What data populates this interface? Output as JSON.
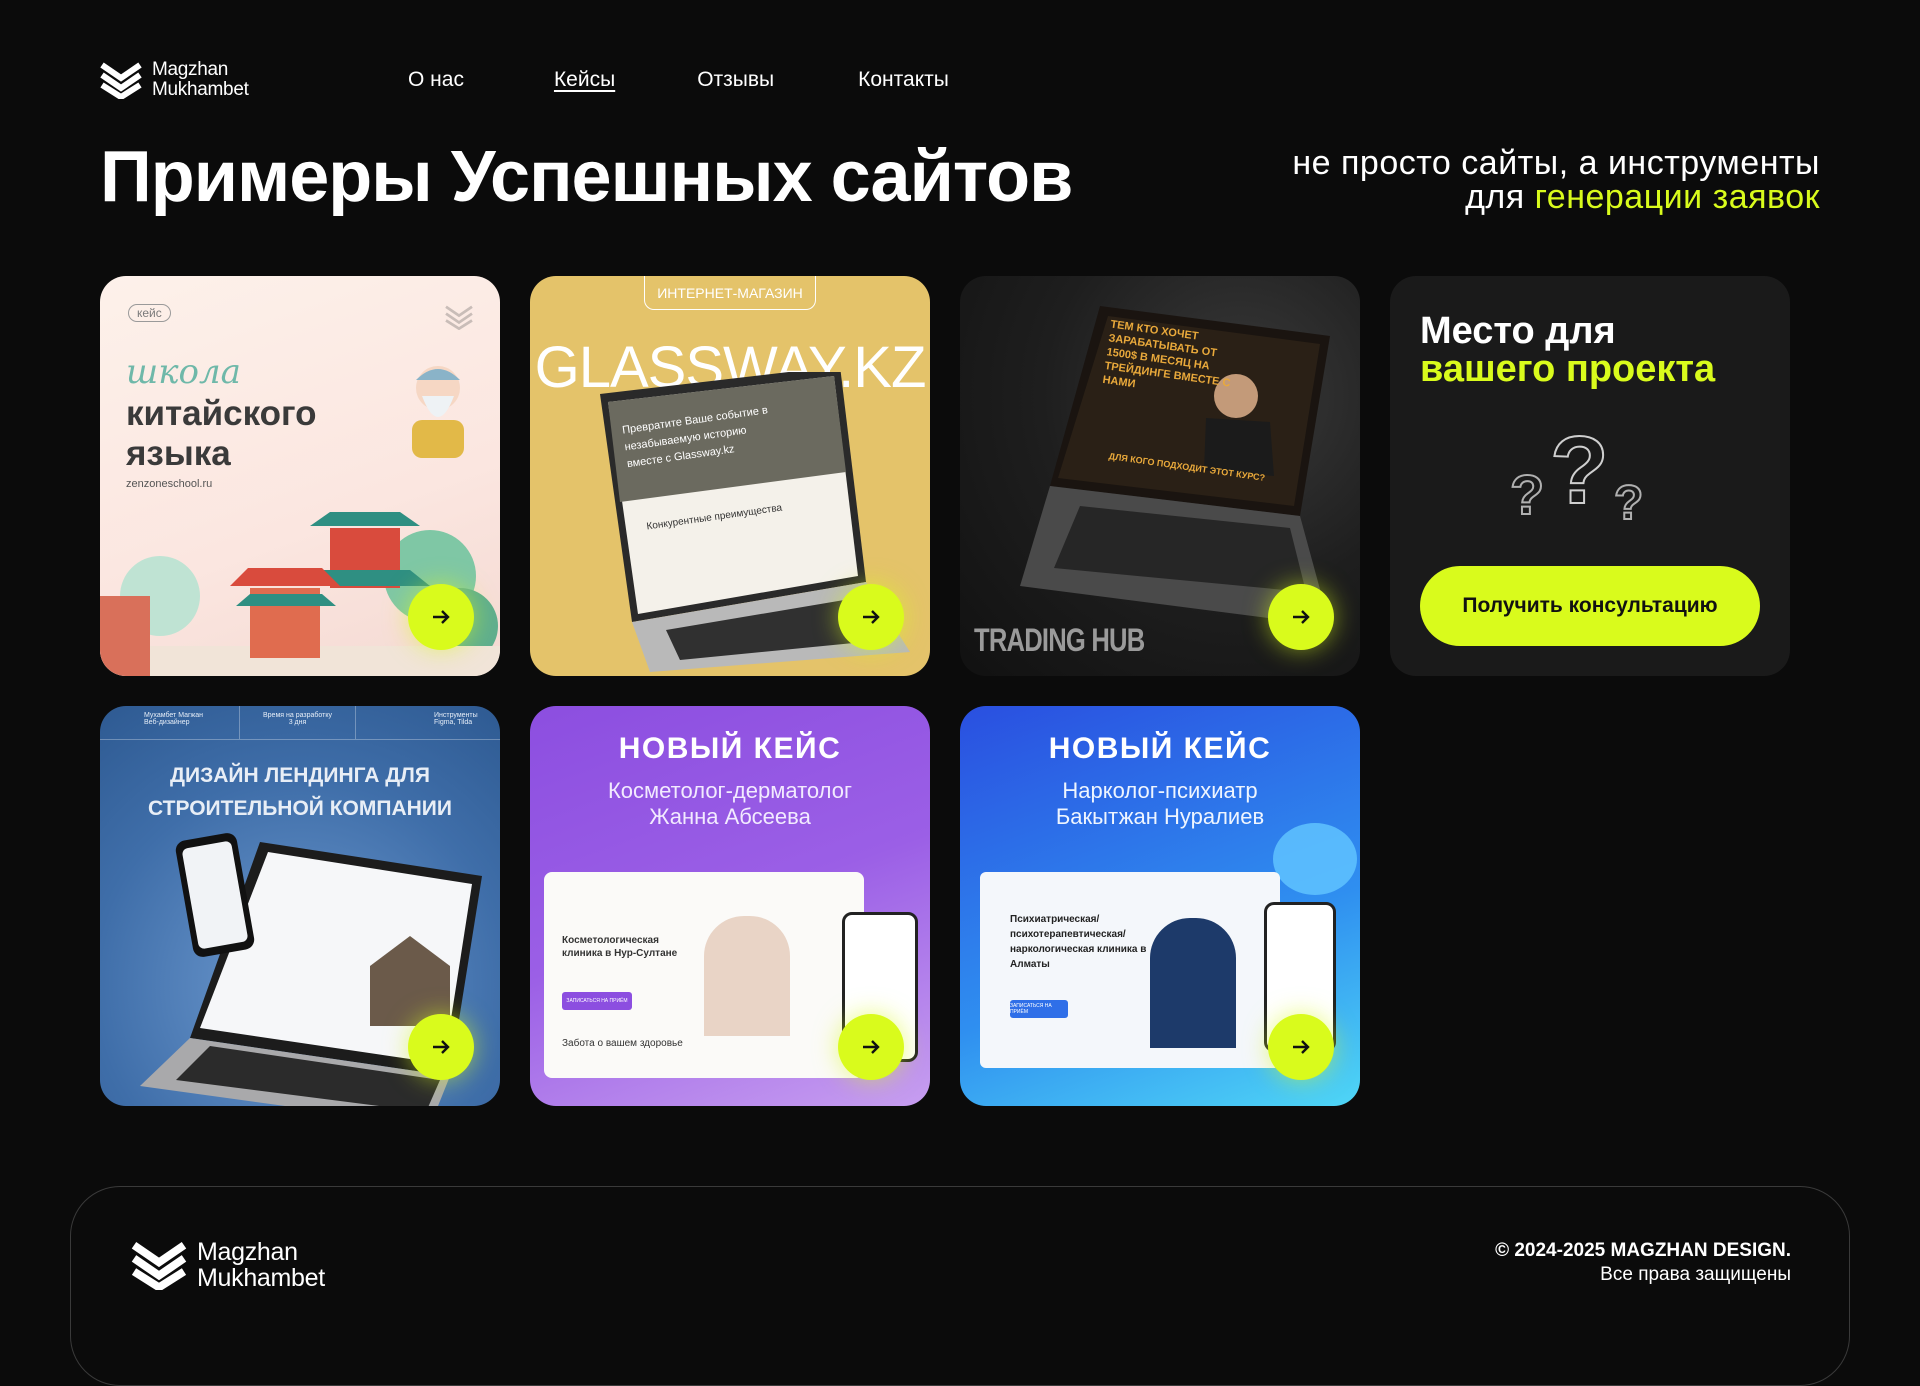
{
  "brand": {
    "line1": "Magzhan",
    "line2": "Mukhambet"
  },
  "nav": [
    {
      "label": "О нас",
      "active": false
    },
    {
      "label": "Кейсы",
      "active": true
    },
    {
      "label": "Отзывы",
      "active": false
    },
    {
      "label": "Контакты",
      "active": false
    }
  ],
  "page_title": "Примеры Успешных сайтов",
  "tagline": {
    "line1": "не просто сайты, а инструменты",
    "line2_prefix": "для ",
    "line2_accent": "генерации заявок"
  },
  "cards": {
    "chinese": {
      "tag": "кейс",
      "script": "школа",
      "title1": "китайского",
      "title2": "языка",
      "url": "zenzoneschool.ru"
    },
    "glassway": {
      "badge": "ИНТЕРНЕТ-МАГАЗИН",
      "brand": "GLASSWAY.KZ",
      "screen_text": "Превратите Ваше событие в незабываемую историю вместе с Glassway.kz",
      "screen_sub": "Конкурентные преимущества"
    },
    "trading": {
      "screen_text": "ТЕМ КТО ХОЧЕТ ЗАРАБАТЫВАТЬ ОТ 1500$ В МЕСЯЦ НА ТРЕЙДИНГЕ ВМЕСТЕ С НАМИ",
      "screen_sub": "ДЛЯ КОГО ПОДХОДИТ ЭТОТ КУРС?",
      "brand": "TRADING HUB"
    },
    "construction": {
      "title1": "ДИЗАЙН ЛЕНДИНГА ДЛЯ",
      "title2": "СТРОИТЕЛЬНОЙ КОМПАНИИ",
      "meta1a": "Мухамбет Магжан",
      "meta1b": "Веб-дизайнер",
      "meta2a": "Время на разработку",
      "meta2b": "3 дня",
      "meta3a": "Инструменты",
      "meta3b": "Figma, Tilda"
    },
    "cosmetology": {
      "badge": "НОВЫЙ КЕЙС",
      "sub1": "Косметолог-дерматолог",
      "sub2": "Жанна Абсеева",
      "screen_title": "Косметологическая клиника в Нур-Султане",
      "screen_footer": "Забота о вашем здоровье",
      "btn": "ЗАПИСАТЬСЯ НА ПРИЁМ"
    },
    "narcology": {
      "badge": "НОВЫЙ КЕЙС",
      "sub1": "Нарколог-психиатр",
      "sub2": "Бакытжан Нуралиев",
      "screen_title": "Психиатрическая/ психотерапевтическая/ наркологическая клиника в Алматы",
      "btn": "ЗАПИСАТЬСЯ НА ПРИЁМ"
    }
  },
  "cta": {
    "title1": "Место для",
    "title2": "вашего проекта",
    "button": "Получить консультацию",
    "glyph": "?"
  },
  "footer": {
    "copyright": "© 2024-2025 MAGZHAN DESIGN.",
    "rights": "Все права защищены"
  },
  "colors": {
    "accent": "#d9fb1c",
    "bg": "#0b0b0b",
    "card_dark": "#1a1a1a"
  },
  "icons": {
    "logo": "chevron-stack-logo",
    "arrow": "arrow-right-icon",
    "question": "question-marks-icon"
  }
}
